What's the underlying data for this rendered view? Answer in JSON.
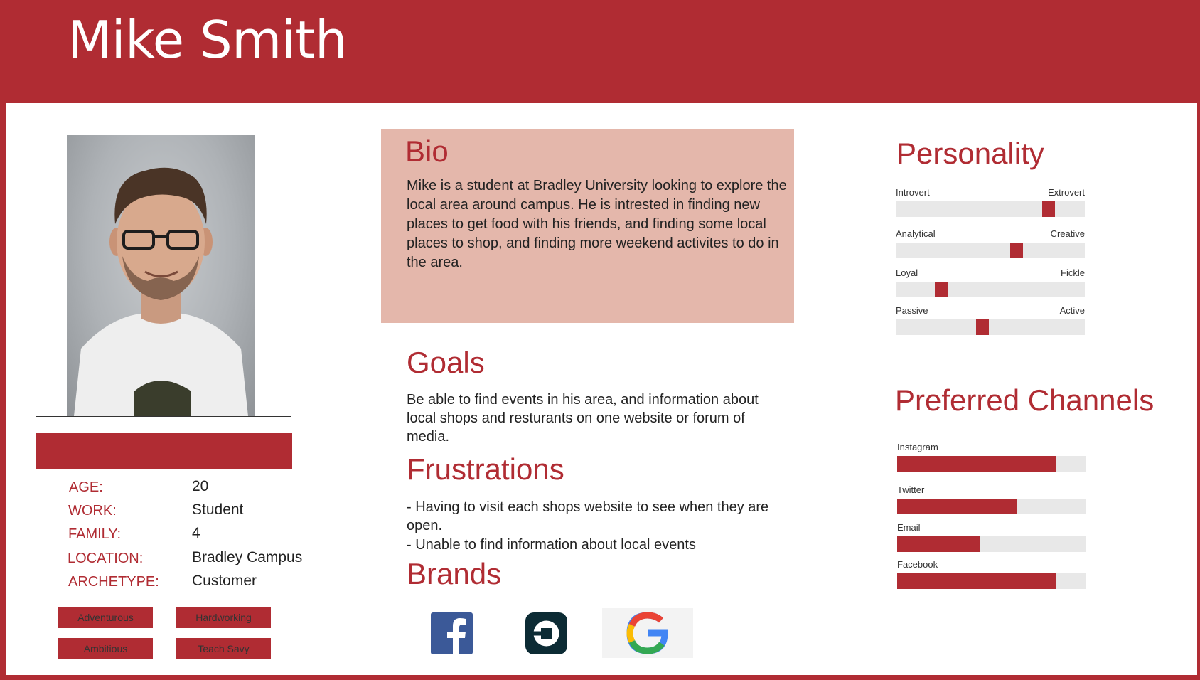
{
  "persona": {
    "name": "Mike Smith"
  },
  "profile": {
    "fields": [
      {
        "label": "AGE:",
        "value": "20"
      },
      {
        "label": "WORK:",
        "value": "Student"
      },
      {
        "label": "FAMILY:",
        "value": "4"
      },
      {
        "label": "LOCATION:",
        "value": "Bradley Campus"
      },
      {
        "label": "ARCHETYPE:",
        "value": "Customer"
      }
    ],
    "tags": [
      "Adventurous",
      "Hardworking",
      "Ambitious",
      "Teach Savy"
    ]
  },
  "bio": {
    "title": "Bio",
    "text": "Mike is a student at Bradley University looking to explore the local area around campus. He is intrested in finding new places to get food with his friends, and finding some local places to shop, and finding more weekend activites to do in the area."
  },
  "goals": {
    "title": "Goals",
    "text": "Be able to find events in his area, and information about local shops and resturants on one website or forum of media."
  },
  "frustrations": {
    "title": "Frustrations",
    "items": [
      "- Having to visit each shops website to see when they are open.",
      "- Unable to find information about local events"
    ]
  },
  "brands": {
    "title": "Brands",
    "logos": [
      "facebook-logo",
      "uber-logo",
      "google-logo"
    ]
  },
  "personality": {
    "title": "Personality",
    "traits": [
      {
        "left": "Introvert",
        "right": "Extrovert",
        "position": 0.81
      },
      {
        "left": "Analytical",
        "right": "Creative",
        "position": 0.64
      },
      {
        "left": "Loyal",
        "right": "Fickle",
        "position": 0.24
      },
      {
        "left": "Passive",
        "right": "Active",
        "position": 0.46
      }
    ]
  },
  "channels": {
    "title": "Preferred Channels",
    "items": [
      {
        "name": "Instagram",
        "level": 0.84
      },
      {
        "name": "Twitter",
        "level": 0.63
      },
      {
        "name": "Email",
        "level": 0.44
      },
      {
        "name": "Facebook",
        "level": 0.84
      }
    ]
  },
  "colors": {
    "accent": "#b02c33",
    "bio_bg": "#e4b7ab",
    "track": "#e8e8e8"
  }
}
